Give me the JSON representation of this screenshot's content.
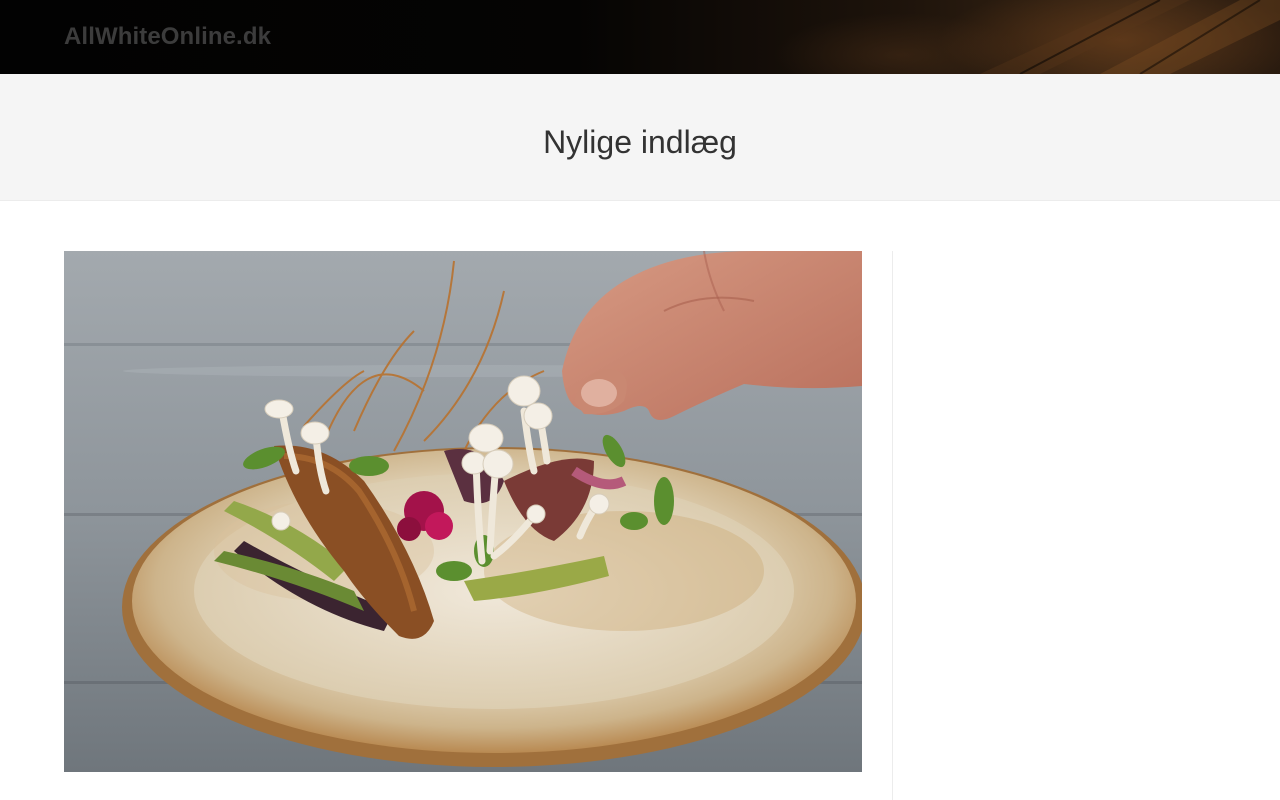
{
  "site": {
    "title": "AllWhiteOnline.dk"
  },
  "page_header": {
    "title": "Nylige indlæg"
  },
  "posts": [
    {
      "thumbnail_subject": "plated-dish-with-mushrooms-image"
    }
  ],
  "colors": {
    "header_bg": "#050403",
    "site_title": "#3c3c3c",
    "page_header_bg": "#f5f5f5",
    "page_title": "#333333",
    "divider": "#ececec"
  }
}
